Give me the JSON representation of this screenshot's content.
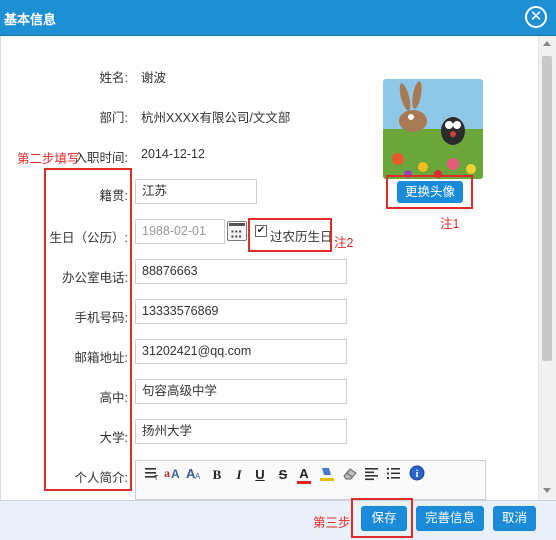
{
  "window": {
    "title": "基本信息",
    "close_glyph": "✕"
  },
  "form": {
    "name": {
      "label": "姓名:",
      "value": "谢波"
    },
    "department": {
      "label": "部门:",
      "value": "杭州XXXX有限公司/文文部"
    },
    "join_date": {
      "label": "入职时间:",
      "value": "2014-12-12"
    },
    "native_place": {
      "label": "籍贯:",
      "value": "江苏"
    },
    "birthday": {
      "label": "生日（公历）:",
      "placeholder": "1988-02-01"
    },
    "lunar_birthday": {
      "label": "过农历生日",
      "checked": true
    },
    "office_phone": {
      "label": "办公室电话:",
      "value": "88876663"
    },
    "mobile": {
      "label": "手机号码:",
      "value": "13333576869"
    },
    "email": {
      "label": "邮箱地址:",
      "value": "31202421@qq.com"
    },
    "high_school": {
      "label": "高中:",
      "value": "句容高级中学"
    },
    "university": {
      "label": "大学:",
      "value": "扬州大学"
    },
    "intro": {
      "label": "个人简介:"
    }
  },
  "avatar": {
    "change_label": "更换头像",
    "icon": "avatar-image"
  },
  "annotations": {
    "step2": "第二步填写",
    "note1": "注1",
    "note2": "注2",
    "step3": "第三步"
  },
  "toolbar": {
    "bold": "B",
    "italic": "I",
    "underline": "U",
    "strike": "S",
    "font_color": "A",
    "info": "i",
    "items": [
      "paragraph-icon",
      "font-family-icon",
      "font-size-icon",
      "bold-icon",
      "italic-icon",
      "underline-icon",
      "strikethrough-icon",
      "font-color-icon",
      "highlight-icon",
      "eraser-icon",
      "align-icon",
      "list-icon",
      "info-icon"
    ]
  },
  "footer": {
    "save": "保存",
    "complete": "完善信息",
    "cancel": "取消"
  },
  "colors": {
    "titlebar": "#1d8fd3",
    "accent": "#1b8ad8",
    "annotation_red": "#e02b2b",
    "footer_bg": "#e9f0f7"
  }
}
